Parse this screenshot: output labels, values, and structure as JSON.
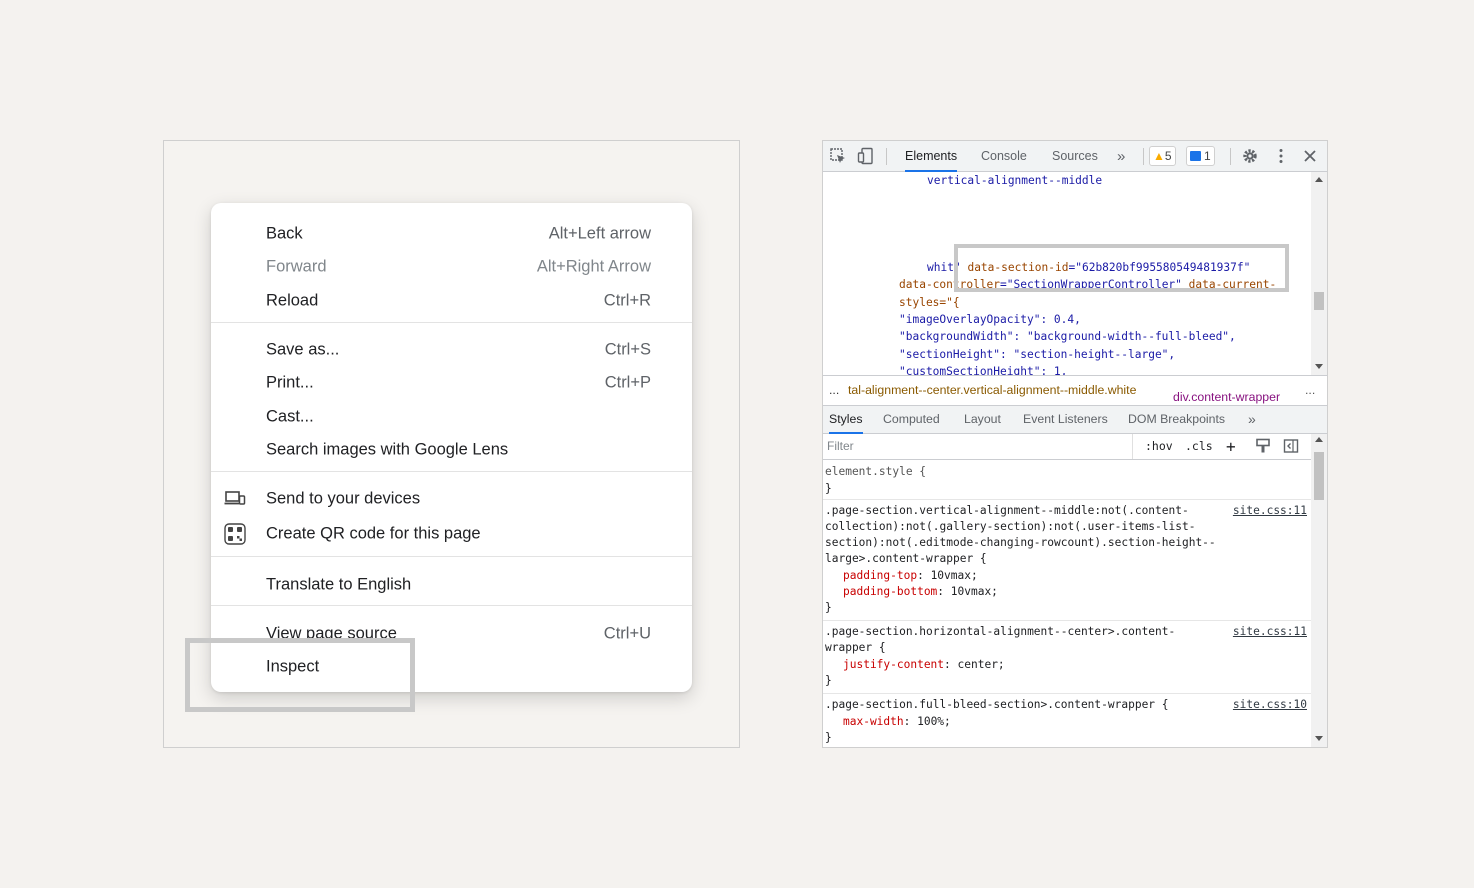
{
  "context_menu": {
    "items": [
      {
        "label": "Back",
        "shortcut": "Alt+Left arrow"
      },
      {
        "label": "Forward",
        "shortcut": "Alt+Right Arrow",
        "disabled": true
      },
      {
        "label": "Reload",
        "shortcut": "Ctrl+R"
      },
      {
        "label": "Save as...",
        "shortcut": "Ctrl+S"
      },
      {
        "label": "Print...",
        "shortcut": "Ctrl+P"
      },
      {
        "label": "Cast...",
        "shortcut": ""
      },
      {
        "label": "Search images with Google Lens",
        "shortcut": ""
      },
      {
        "label": "Send to your devices",
        "shortcut": "",
        "icon": "devices-icon"
      },
      {
        "label": "Create QR code for this page",
        "shortcut": "",
        "icon": "qr-code-icon"
      },
      {
        "label": "Translate to English",
        "shortcut": ""
      },
      {
        "label": "View page source",
        "shortcut": "Ctrl+U"
      },
      {
        "label": "Inspect",
        "shortcut": ""
      }
    ]
  },
  "devtools": {
    "tabs": [
      "Elements",
      "Console",
      "Sources"
    ],
    "more_tabs": "»",
    "warnings_count": "5",
    "messages_count": "1",
    "code_lines": {
      "l1": "vertical-alignment--middle",
      "l2_prefix": "whit",
      "l2_quote": "\"",
      "l2_attr": "data-section-id",
      "l2_val": "=\"62b820bf995580549481937f\"",
      "l3_attr": "data-controller",
      "l3_val": "=\"SectionWrapperController\"",
      "l3_rest": " data-current-",
      "l4": "styles=\"{",
      "l5": "\"imageOverlayOpacity\": 0.4,",
      "l6": "\"backgroundWidth\": \"background-width--full-bleed\",",
      "l7": "\"sectionHeight\": \"section-height--large\",",
      "l8": "\"customSectionHeight\": 1,"
    },
    "breadcrumbs": {
      "ellipsis": "...",
      "item1": "tal-alignment--center.vertical-alignment--middle.white",
      "item2": "div.content-wrapper",
      "trailing": "..."
    },
    "subtabs": [
      "Styles",
      "Computed",
      "Layout",
      "Event Listeners",
      "DOM Breakpoints"
    ],
    "subtabs_more": "»",
    "filter_placeholder": "Filter",
    "filter_buttons": {
      "hov": ":hov",
      "cls": ".cls",
      "plus": "+"
    },
    "styles": {
      "element_style_open": "element.style {",
      "close": "}",
      "r1_l1": ".page-section.vertical-alignment--middle:not(.content-",
      "r1_l2": "collection):not(.gallery-section):not(.user-items-list-",
      "r1_l3": "section):not(.editmode-changing-rowcount).section-height--",
      "r1_l4": "large>.content-wrapper {",
      "r1_p1_name": "padding-top",
      "r1_p1_val": ": 10vmax;",
      "r1_p2_name": "padding-bottom",
      "r1_p2_val": ": 10vmax;",
      "r1_src": "site.css:11",
      "r2_l1": ".page-section.horizontal-alignment--center>.content-",
      "r2_l2": "wrapper {",
      "r2_p1_name": "justify-content",
      "r2_p1_val": ": center;",
      "r2_src": "site.css:11",
      "r3_l1": ".page-section.full-bleed-section>.content-wrapper {",
      "r3_p1_name": "max-width",
      "r3_p1_val": ": 100%;",
      "r3_src": "site.css:10"
    }
  },
  "colors": {
    "accent": "#1a73e8",
    "warning": "#f9ab00",
    "attr_name": "#994500",
    "attr_value": "#1a1aa6",
    "css_property": "#c80000",
    "highlight_box": "#c8c8c8"
  }
}
